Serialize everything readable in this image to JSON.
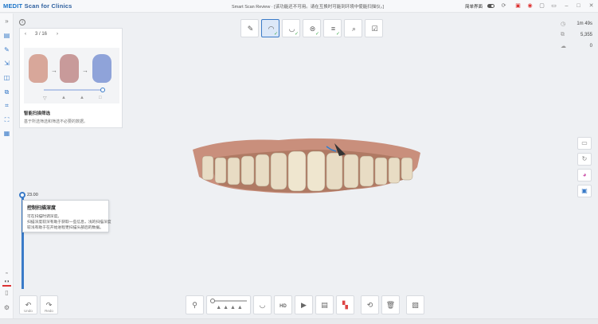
{
  "app": {
    "brand": "MEDIT",
    "name": "Scan for Clinics"
  },
  "titlebar": {
    "center_text": "Smart Scan Review · [该功能还不可用。请在互换时可能到环境中使能扫描仪。]",
    "simple_mode_label": "简单界面"
  },
  "guide_card": {
    "page_indicator": "3 / 16",
    "title": "智能扫描筛选",
    "description": "基于所选筛选和筛选不必要的数据。"
  },
  "scan_depth": {
    "value": "23.00",
    "tooltip_title": "控制扫描深度",
    "tooltip_lines": [
      "可在扫描时调深度。",
      "扫描深度较深有助于获取一些信息，浅的扫描深度",
      "较浅有助于在开始进程更扫描头部后的数据。"
    ]
  },
  "stats": {
    "time": "1m 49s",
    "count": "5,355",
    "count2": "0"
  },
  "undo": {
    "label": "Undo"
  },
  "redo": {
    "label": "Redo"
  },
  "hd": {
    "label": "HD"
  },
  "icons": {
    "steps": [
      "pencil-icon",
      "upper-jaw-icon",
      "lower-jaw-icon",
      "occlusion-icon",
      "bite-icon",
      "scan-review-icon",
      "check-icon"
    ],
    "left_tools": [
      "scan-icon",
      "edit-icon",
      "export-icon",
      "view-icon",
      "align-icon",
      "trim-icon",
      "fit-icon",
      "compare-icon"
    ]
  }
}
